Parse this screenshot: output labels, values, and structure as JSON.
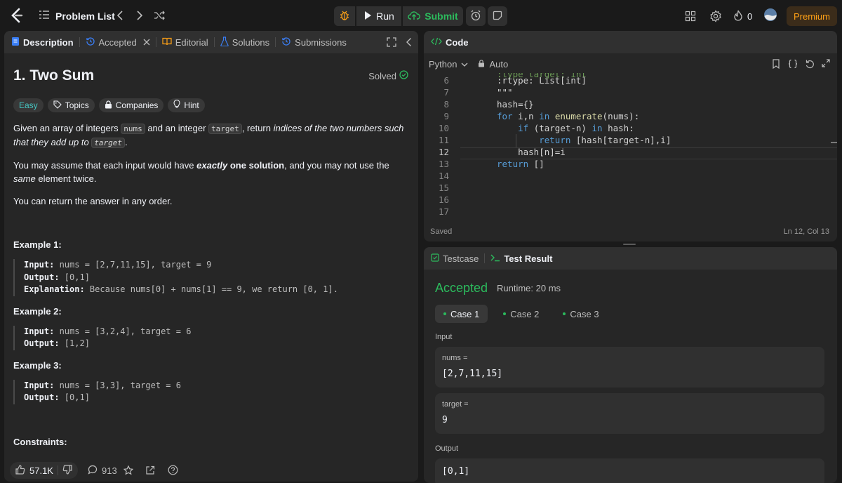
{
  "topbar": {
    "problem_list": "Problem List",
    "run": "Run",
    "submit": "Submit",
    "streak": "0",
    "premium": "Premium"
  },
  "left": {
    "tabs": [
      "Description",
      "Accepted",
      "Editorial",
      "Solutions",
      "Submissions"
    ],
    "title": "1. Two Sum",
    "solved": "Solved",
    "chips": [
      "Easy",
      "Topics",
      "Companies",
      "Hint"
    ],
    "p1": {
      "a": "Given an array of integers ",
      "nums": "nums",
      "b": " and an integer ",
      "target": "target",
      "c": ", return ",
      "d": "indices of the two numbers such that they add up to ",
      "target2": "target",
      "e": "."
    },
    "p2": {
      "a": "You may assume that each input would have ",
      "b": "exactly",
      "c": " one solution",
      "d": ", and you may not use the ",
      "e": "same",
      "f": " element twice."
    },
    "p3": "You can return the answer in any order.",
    "examples": [
      {
        "title": "Example 1:",
        "input_label": "Input:",
        "input": " nums = [2,7,11,15], target = 9",
        "output_label": "Output:",
        "output": " [0,1]",
        "expl_label": "Explanation:",
        "expl": " Because nums[0] + nums[1] == 9, we return [0, 1]."
      },
      {
        "title": "Example 2:",
        "input_label": "Input:",
        "input": " nums = [3,2,4], target = 6",
        "output_label": "Output:",
        "output": " [1,2]"
      },
      {
        "title": "Example 3:",
        "input_label": "Input:",
        "input": " nums = [3,3], target = 6",
        "output_label": "Output:",
        "output": " [0,1]"
      }
    ],
    "constraints": "Constraints:",
    "likes": "57.1K",
    "comments": "913"
  },
  "code": {
    "tab": "Code",
    "language": "Python",
    "auto": "Auto",
    "saved": "Saved",
    "cursor": "Ln 12, Col 13",
    "lines": [
      {
        "n": "6",
        "t": ":rtype: List[int]"
      },
      {
        "n": "7",
        "t": "\"\"\""
      },
      {
        "n": "8",
        "t": "hash={}"
      },
      {
        "n": "9",
        "t": "for i,n in enumerate(nums):"
      },
      {
        "n": "10",
        "t": "    if (target-n) in hash:"
      },
      {
        "n": "11",
        "t": "        return [hash[target-n],i]"
      },
      {
        "n": "12",
        "t": "    hash[n]=i"
      },
      {
        "n": "13",
        "t": "return []"
      },
      {
        "n": "14",
        "t": ""
      },
      {
        "n": "15",
        "t": ""
      },
      {
        "n": "16",
        "t": ""
      },
      {
        "n": "17",
        "t": ""
      }
    ]
  },
  "test": {
    "tabs": [
      "Testcase",
      "Test Result"
    ],
    "status": "Accepted",
    "runtime": "Runtime: 20 ms",
    "cases": [
      "Case 1",
      "Case 2",
      "Case 3"
    ],
    "input_label": "Input",
    "nums_label": "nums =",
    "nums_value": "[2,7,11,15]",
    "target_label": "target =",
    "target_value": "9",
    "output_label": "Output",
    "output_value": "[0,1]"
  },
  "colors": {
    "accent_green": "#2cbb5d",
    "premium_orange": "#ffa116",
    "easy_teal": "#46c6c2"
  }
}
